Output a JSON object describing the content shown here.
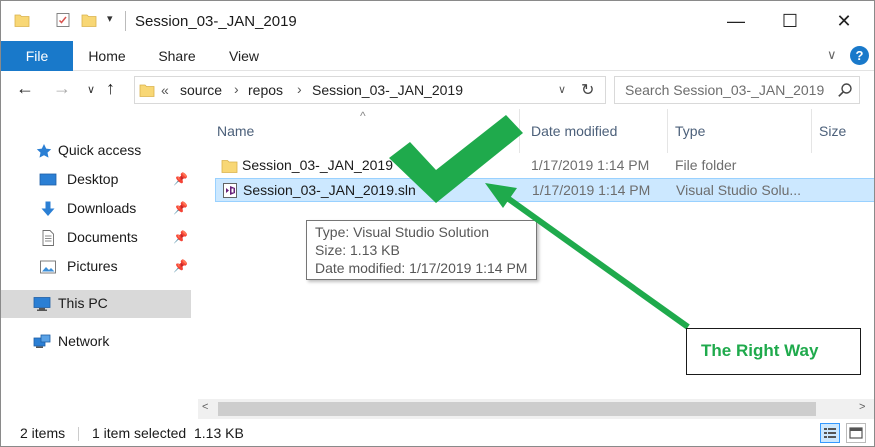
{
  "window": {
    "title": "Session_03-_JAN_2019",
    "minimize_glyph": "—",
    "maximize_glyph": "☐",
    "close_glyph": "✕"
  },
  "ribbon": {
    "tabs": [
      "File",
      "Home",
      "Share",
      "View"
    ],
    "expand_glyph": "∨",
    "help_glyph": "?"
  },
  "address": {
    "back_glyph": "←",
    "forward_glyph": "→",
    "recent_glyph": "∨",
    "up_glyph": "↑",
    "overflow": "«",
    "crumbs": [
      "source",
      "repos",
      "Session_03-_JAN_2019"
    ],
    "chevron": "›",
    "dropdown_glyph": "∨",
    "refresh_glyph": "↻"
  },
  "search": {
    "placeholder": "Search Session_03-_JAN_2019"
  },
  "navpane": {
    "quick_access": "Quick access",
    "items": [
      {
        "label": "Desktop",
        "icon": "desktop-icon",
        "pinned": true
      },
      {
        "label": "Downloads",
        "icon": "downloads-icon",
        "pinned": true
      },
      {
        "label": "Documents",
        "icon": "documents-icon",
        "pinned": true
      },
      {
        "label": "Pictures",
        "icon": "pictures-icon",
        "pinned": true
      }
    ],
    "this_pc": "This PC",
    "network": "Network",
    "pin_glyph": "📌"
  },
  "columns": {
    "name": "Name",
    "date": "Date modified",
    "type": "Type",
    "size": "Size",
    "sort_glyph": "^"
  },
  "files": [
    {
      "name": "Session_03-_JAN_2019",
      "date": "1/17/2019 1:14 PM",
      "type": "File folder",
      "icon": "folder-icon",
      "selected": false
    },
    {
      "name": "Session_03-_JAN_2019.sln",
      "date": "1/17/2019 1:14 PM",
      "type": "Visual Studio Solu...",
      "icon": "vs-solution-icon",
      "selected": true
    }
  ],
  "tooltip": {
    "type": "Type: Visual Studio Solution",
    "size": "Size: 1.13 KB",
    "date": "Date modified: 1/17/2019 1:14 PM"
  },
  "scroll": {
    "left_glyph": "<",
    "right_glyph": ">"
  },
  "status": {
    "items": "2 items",
    "selected": "1 item selected",
    "size": "1.13 KB"
  },
  "annotation": {
    "label": "The Right Way",
    "color": "#1faa4c"
  },
  "colors": {
    "accent": "#1979ca",
    "selection": "#cce8ff",
    "selection_border": "#99d1ff",
    "annotation_green": "#1faa4c"
  }
}
